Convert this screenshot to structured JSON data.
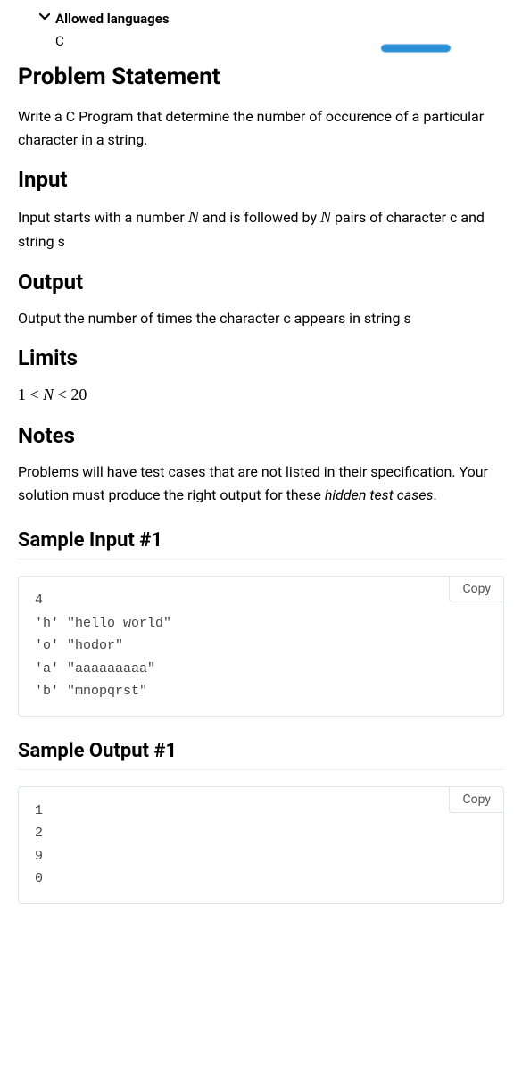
{
  "allowed_languages": {
    "label": "Allowed languages",
    "value": "C"
  },
  "headings": {
    "problem_statement": "Problem Statement",
    "input": "Input",
    "output": "Output",
    "limits": "Limits",
    "notes": "Notes",
    "sample_input_1": "Sample Input #1",
    "sample_output_1": "Sample Output #1"
  },
  "paragraphs": {
    "problem_statement": "Write a C Program that determine the number of occurence of a particular character in a string.",
    "input_pre": "Input starts with a number ",
    "input_mid": " and is followed by ",
    "input_post": " pairs of character c and string s",
    "output": "Output the number of times the character c appears in string s",
    "notes_pre": "Problems will have test cases that are not listed in their specification. Your solution must produce the right output for these ",
    "notes_hidden": "hidden test cases",
    "notes_post": "."
  },
  "math": {
    "var_n": "N",
    "limits_expr": "1 < N < 20"
  },
  "samples": {
    "input_1": "4\n'h' \"hello world\"\n'o' \"hodor\"\n'a' \"aaaaaaaaa\"\n'b' \"mnopqrst\"",
    "output_1": "1\n2\n9\n0"
  },
  "buttons": {
    "copy": "Copy"
  }
}
